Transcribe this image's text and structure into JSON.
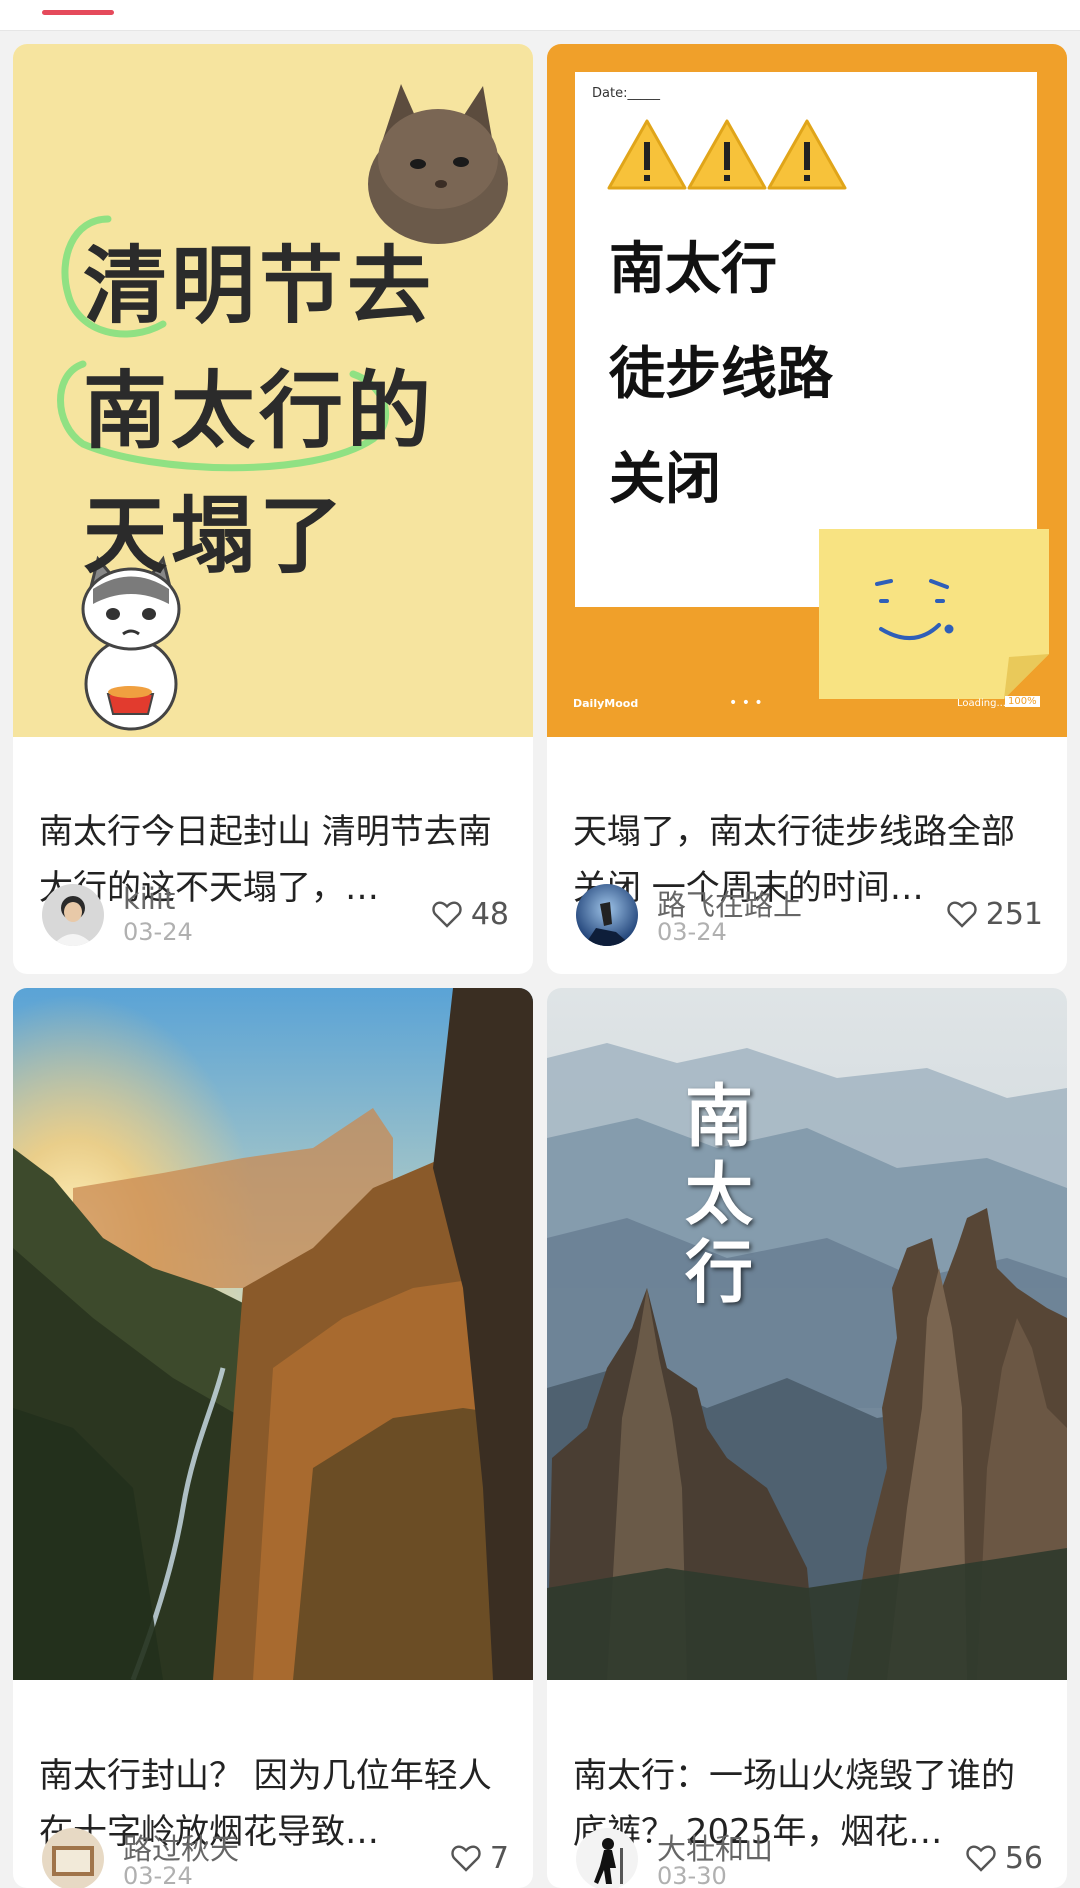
{
  "colors": {
    "accent": "#e54a5b",
    "card1_bg": "#f6e49f",
    "card2_bg": "#f0a02a",
    "sticky_note": "#f8e382"
  },
  "feed": [
    {
      "title": "南太行今日起封山 清明节去南太行的这不天塌了，…",
      "author": "kiiit",
      "date": "03-24",
      "likes": "48",
      "cover": {
        "lines": [
          "清明节去",
          "南太行的",
          "天塌了"
        ]
      }
    },
    {
      "title": "天塌了，南太行徒步线路全部关闭 一个周末的时间…",
      "author": "路飞在路上",
      "date": "03-24",
      "likes": "251",
      "cover": {
        "date_label": "Date:_____",
        "lines": [
          "南太行",
          "徒步线路",
          "关闭"
        ],
        "brand": "DailyMood",
        "loading": "Loading...",
        "percent": "100%"
      }
    },
    {
      "title": "南太行封山？ 因为几位年轻人在十字岭放烟花导致…",
      "author": "路过秋天",
      "date": "03-24",
      "likes": "7"
    },
    {
      "title": "南太行：一场山火烧毁了谁的底裤？ 2025年，烟花…",
      "author": "大壮和山",
      "date": "03-30",
      "likes": "56",
      "cover": {
        "vertical_text": "南太行"
      }
    }
  ]
}
